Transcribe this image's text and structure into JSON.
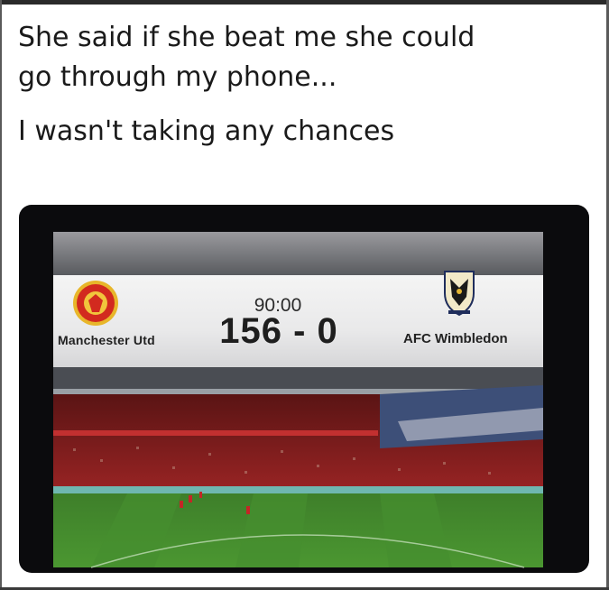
{
  "caption": {
    "line1": "She said if she beat me she could",
    "line2": "go through my phone...",
    "line3": "I wasn't taking any chances"
  },
  "scoreboard": {
    "clock": "90:00",
    "score": "156 - 0",
    "home_team": "Manchester Utd",
    "away_team": "AFC Wimbledon"
  },
  "colors": {
    "pitch": "#3f8a2b",
    "stands": "#8a1b1b",
    "scorebar": "#ececec"
  },
  "icons": {
    "home_crest": "manchester-united-crest-icon",
    "away_crest": "afc-wimbledon-crest-icon"
  }
}
